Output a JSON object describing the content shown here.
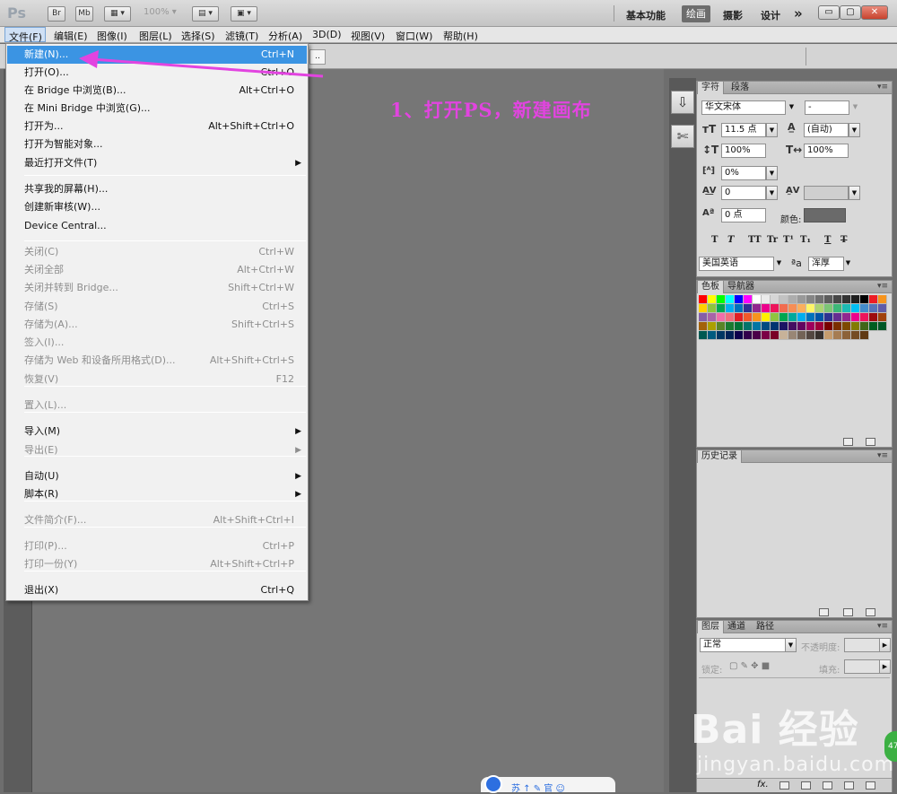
{
  "app": {
    "logo": "Ps",
    "bridge_btn": "Br",
    "minibridge_btn": "Mb",
    "zoom": "100%",
    "workspaces": [
      "基本功能",
      "绘画",
      "摄影",
      "设计"
    ],
    "active_workspace": "绘画",
    "more": "»"
  },
  "menubar": [
    "文件(F)",
    "编辑(E)",
    "图像(I)",
    "图层(L)",
    "选择(S)",
    "滤镜(T)",
    "分析(A)",
    "3D(D)",
    "视图(V)",
    "窗口(W)",
    "帮助(H)"
  ],
  "options_bar": {
    "field_text": ".."
  },
  "file_menu": {
    "items": [
      {
        "label": "新建(N)...",
        "shortcut": "Ctrl+N",
        "selected": true
      },
      {
        "label": "打开(O)...",
        "shortcut": "Ctrl+O"
      },
      {
        "label": "在 Bridge 中浏览(B)...",
        "shortcut": "Alt+Ctrl+O"
      },
      {
        "label": "在 Mini Bridge 中浏览(G)...",
        "shortcut": ""
      },
      {
        "label": "打开为...",
        "shortcut": "Alt+Shift+Ctrl+O"
      },
      {
        "label": "打开为智能对象...",
        "shortcut": ""
      },
      {
        "label": "最近打开文件(T)",
        "shortcut": "",
        "submenu": true
      },
      {
        "label": "共享我的屏幕(H)...",
        "shortcut": ""
      },
      {
        "label": "创建新审核(W)...",
        "shortcut": ""
      },
      {
        "label": "Device Central...",
        "shortcut": ""
      },
      {
        "label": "关闭(C)",
        "shortcut": "Ctrl+W",
        "disabled": true
      },
      {
        "label": "关闭全部",
        "shortcut": "Alt+Ctrl+W",
        "disabled": true
      },
      {
        "label": "关闭并转到 Bridge...",
        "shortcut": "Shift+Ctrl+W",
        "disabled": true
      },
      {
        "label": "存储(S)",
        "shortcut": "Ctrl+S",
        "disabled": true
      },
      {
        "label": "存储为(A)...",
        "shortcut": "Shift+Ctrl+S",
        "disabled": true
      },
      {
        "label": "签入(I)...",
        "shortcut": "",
        "disabled": true
      },
      {
        "label": "存储为 Web 和设备所用格式(D)...",
        "shortcut": "Alt+Shift+Ctrl+S",
        "disabled": true
      },
      {
        "label": "恢复(V)",
        "shortcut": "F12",
        "disabled": true
      },
      {
        "label": "置入(L)...",
        "shortcut": "",
        "disabled": true
      },
      {
        "label": "导入(M)",
        "shortcut": "",
        "submenu": true
      },
      {
        "label": "导出(E)",
        "shortcut": "",
        "submenu": true,
        "disabled": true
      },
      {
        "label": "自动(U)",
        "shortcut": "",
        "submenu": true
      },
      {
        "label": "脚本(R)",
        "shortcut": "",
        "submenu": true
      },
      {
        "label": "文件简介(F)...",
        "shortcut": "Alt+Shift+Ctrl+I",
        "disabled": true
      },
      {
        "label": "打印(P)...",
        "shortcut": "Ctrl+P",
        "disabled": true
      },
      {
        "label": "打印一份(Y)",
        "shortcut": "Alt+Shift+Ctrl+P",
        "disabled": true
      },
      {
        "label": "退出(X)",
        "shortcut": "Ctrl+Q"
      }
    ]
  },
  "annotation": "1、打开PS，新建画布",
  "character_panel": {
    "tabs": [
      "字符",
      "段落"
    ],
    "font_family": "华文宋体",
    "font_style": "-",
    "font_size": "11.5 点",
    "leading": "(自动)",
    "vertical_scale": "100%",
    "horizontal_scale": "100%",
    "baseline_shift_pct": "0%",
    "kerning": "0",
    "tracking": "",
    "baseline": "0 点",
    "color_label": "颜色:",
    "text_color": "#6a6a6a",
    "style_buttons": [
      "T",
      "T",
      "TT",
      "Tr",
      "T¹",
      "T₁",
      "T",
      "T"
    ],
    "language": "美国英语",
    "antialias_icon": "ªa",
    "antialias": "浑厚"
  },
  "swatch_panel": {
    "tabs": [
      "色板",
      "导航器"
    ],
    "colors": [
      "#ff0000",
      "#ffff00",
      "#00ff00",
      "#00ffff",
      "#0000ff",
      "#ff00ff",
      "#ffffff",
      "#ebebeb",
      "#d6d6d6",
      "#c2c2c2",
      "#adadad",
      "#999999",
      "#858585",
      "#707070",
      "#5c5c5c",
      "#474747",
      "#333333",
      "#1f1f1f",
      "#000000",
      "#ed1c24",
      "#f7941d",
      "#ffd200",
      "#8dc63f",
      "#00a651",
      "#00aeef",
      "#0072bc",
      "#2e3192",
      "#92278f",
      "#ec008c",
      "#ed145b",
      "#f26c4f",
      "#f68e56",
      "#fbaf5d",
      "#fff568",
      "#acd373",
      "#7cc576",
      "#3cb878",
      "#1cbbb4",
      "#00bff3",
      "#448ccb",
      "#5674b9",
      "#605ca8",
      "#855fa8",
      "#a864a8",
      "#f06ea9",
      "#f26d7d",
      "#e31e24",
      "#f1592a",
      "#f7941e",
      "#fff200",
      "#8ec641",
      "#00a650",
      "#00a99d",
      "#00aeef",
      "#0072bc",
      "#0054a6",
      "#2e3191",
      "#662d91",
      "#91278f",
      "#ed008c",
      "#ee145b",
      "#9e0b0f",
      "#a0410d",
      "#a3620a",
      "#aba000",
      "#598527",
      "#197b30",
      "#007236",
      "#00746b",
      "#0076a3",
      "#004b80",
      "#003471",
      "#1b1464",
      "#440e62",
      "#630460",
      "#9e005d",
      "#9e0039",
      "#790000",
      "#7b2e00",
      "#7d4900",
      "#827b00",
      "#406618",
      "#005e20",
      "#005826",
      "#005952",
      "#005b7f",
      "#003663",
      "#002157",
      "#0d004c",
      "#32004b",
      "#4b0049",
      "#7b0046",
      "#7a0026",
      "#c7b299",
      "#998675",
      "#736357",
      "#534741",
      "#37302d",
      "#c69c6d",
      "#a67c52",
      "#8c6239",
      "#754c24",
      "#603913"
    ]
  },
  "history_panel": {
    "tabs": [
      "历史记录"
    ]
  },
  "layers_panel": {
    "tabs": [
      "图层",
      "通道",
      "路径"
    ],
    "blend_mode": "正常",
    "opacity_label": "不透明度:",
    "lock_label": "锁定:",
    "fill_label": "填充:",
    "footer_fx": "fx."
  },
  "watermark": {
    "brand": "Bai 经验",
    "url": "jingyan.baidu.com"
  },
  "bubble": {
    "text": "苏  ↑  ✎ 官 ☺"
  },
  "badge": "47"
}
